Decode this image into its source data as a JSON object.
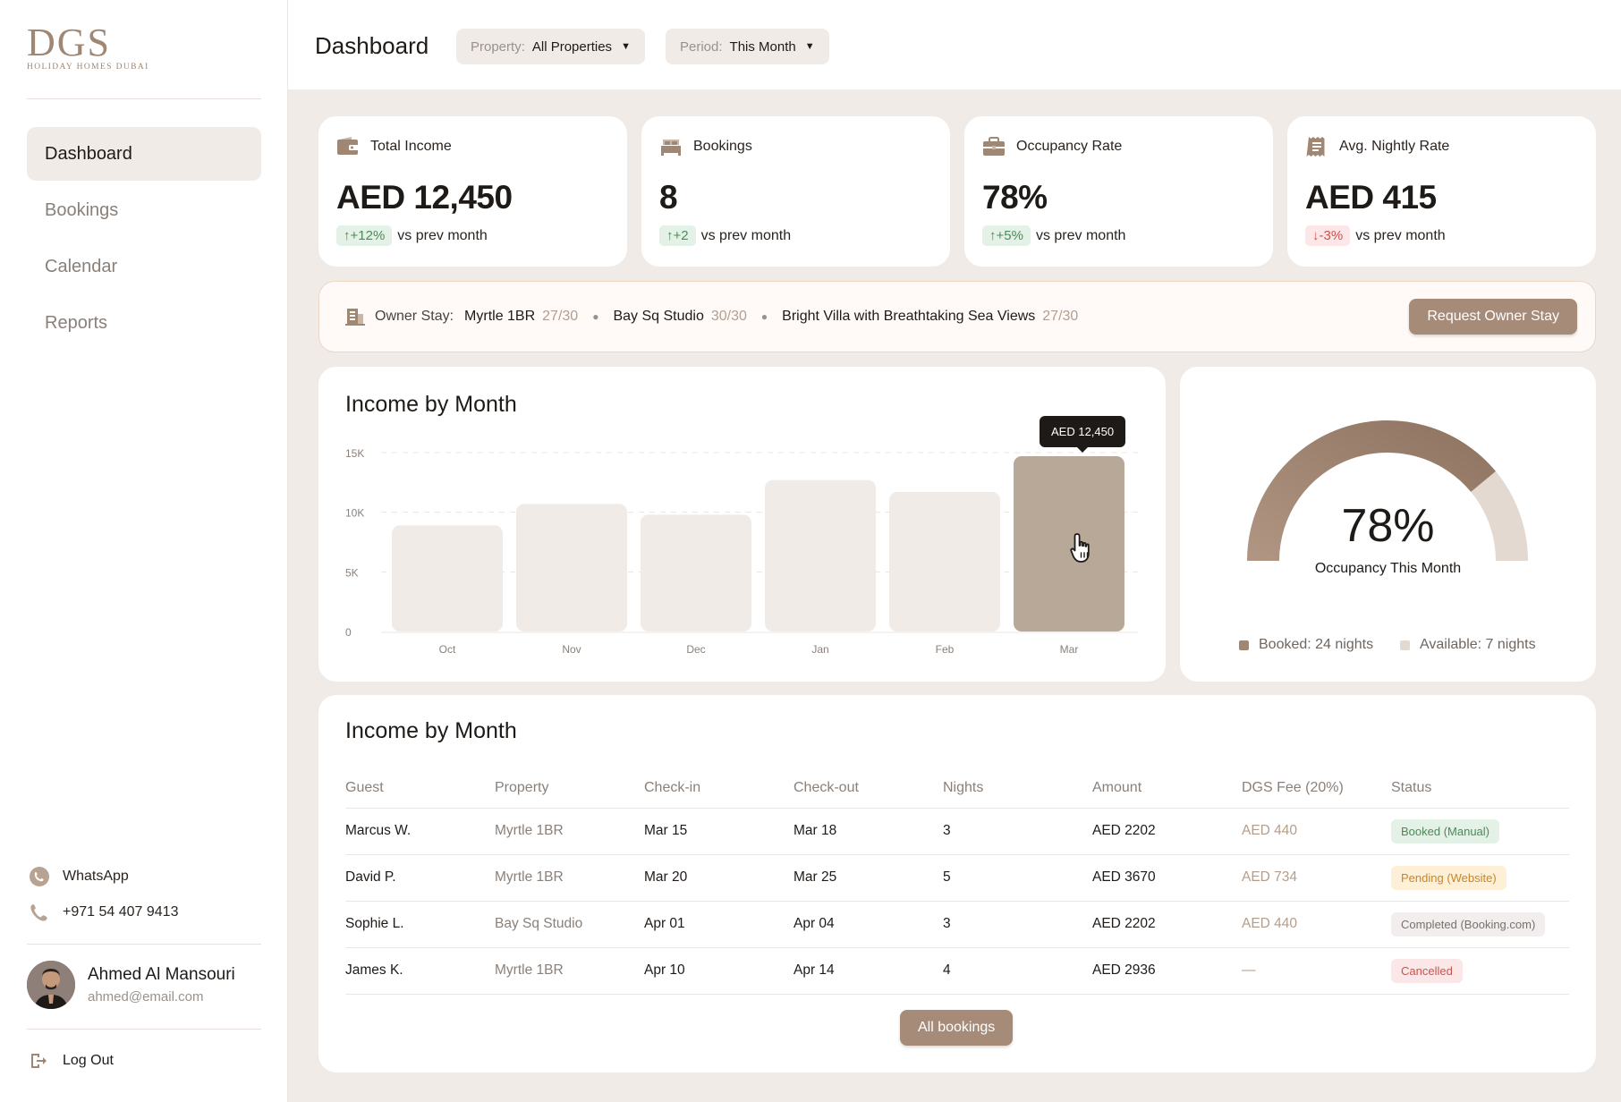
{
  "brand": {
    "logo_text": "DGS",
    "logo_subtitle": "HOLIDAY HOMES DUBAI"
  },
  "sidebar": {
    "items": [
      {
        "label": "Dashboard",
        "active": true
      },
      {
        "label": "Bookings",
        "active": false
      },
      {
        "label": "Calendar",
        "active": false
      },
      {
        "label": "Reports",
        "active": false
      }
    ],
    "whatsapp_label": "WhatsApp",
    "phone": "+971 54 407 9413",
    "user": {
      "name": "Ahmed Al Mansouri",
      "email": "ahmed@email.com"
    },
    "logout_label": "Log Out"
  },
  "header": {
    "title": "Dashboard",
    "property_filter": {
      "label": "Property:",
      "value": "All Properties"
    },
    "period_filter": {
      "label": "Period:",
      "value": "This Month"
    }
  },
  "stats": [
    {
      "label": "Total Income",
      "icon": "wallet-icon",
      "value": "AED 12,450",
      "delta": "↑+12%",
      "trend": "up",
      "compare": "vs prev month"
    },
    {
      "label": "Bookings",
      "icon": "bed-icon",
      "value": "8",
      "delta": "↑+2",
      "trend": "up",
      "compare": "vs prev month"
    },
    {
      "label": "Occupancy Rate",
      "icon": "briefcase-icon",
      "value": "78%",
      "delta": "↑+5%",
      "trend": "up",
      "compare": "vs prev month"
    },
    {
      "label": "Avg. Nightly Rate",
      "icon": "receipt-icon",
      "value": "AED 415",
      "delta": "↓-3%",
      "trend": "down",
      "compare": "vs prev month"
    }
  ],
  "owner_stay": {
    "label": "Owner Stay:",
    "properties": [
      {
        "name": "Myrtle 1BR",
        "count": "27/30"
      },
      {
        "name": "Bay Sq Studio",
        "count": "30/30"
      },
      {
        "name": "Bright Villa with Breathtaking Sea Views",
        "count": "27/30"
      }
    ],
    "button_label": "Request Owner Stay"
  },
  "income_chart": {
    "title": "Income by Month",
    "tooltip": "AED 12,450",
    "highlight_index": 5
  },
  "chart_data": {
    "type": "bar",
    "categories": [
      "Oct",
      "Nov",
      "Dec",
      "Jan",
      "Feb",
      "Mar"
    ],
    "values": [
      8900,
      10700,
      9800,
      12700,
      11700,
      14700
    ],
    "ylim": [
      0,
      15000
    ],
    "yticks": [
      0,
      5000,
      10000,
      15000
    ],
    "ytick_labels": [
      "0",
      "5K",
      "10K",
      "15K"
    ],
    "grid": true,
    "colors": {
      "bar": "#f1ebe8",
      "highlight": "#b8a898"
    }
  },
  "occupancy": {
    "value": "78%",
    "fraction": 0.78,
    "label": "Occupancy This Month",
    "booked_legend": "Booked: 24 nights",
    "available_legend": "Available: 7 nights",
    "colors": {
      "booked": "#a08773",
      "available": "#e3d9d1"
    }
  },
  "bookings_table": {
    "title": "Income by Month",
    "columns": [
      "Guest",
      "Property",
      "Check-in",
      "Check-out",
      "Nights",
      "Amount",
      "DGS Fee (20%)",
      "Status"
    ],
    "rows": [
      {
        "guest": "Marcus W.",
        "property": "Myrtle 1BR",
        "checkin": "Mar 15",
        "checkout": "Mar 18",
        "nights": "3",
        "amount": "AED 2202",
        "fee": "AED 440",
        "status": "Booked (Manual)",
        "status_tone": "green"
      },
      {
        "guest": "David P.",
        "property": "Myrtle 1BR",
        "checkin": "Mar 20",
        "checkout": "Mar 25",
        "nights": "5",
        "amount": "AED 3670",
        "fee": "AED 734",
        "status": "Pending (Website)",
        "status_tone": "yellow"
      },
      {
        "guest": "Sophie L.",
        "property": "Bay Sq Studio",
        "checkin": "Apr 01",
        "checkout": "Apr 04",
        "nights": "3",
        "amount": "AED 2202",
        "fee": "AED 440",
        "status": "Completed (Booking.com)",
        "status_tone": "grey"
      },
      {
        "guest": "James K.",
        "property": "Myrtle 1BR",
        "checkin": "Apr 10",
        "checkout": "Apr 14",
        "nights": "4",
        "amount": "AED 2936",
        "fee": "—",
        "status": "Cancelled",
        "status_tone": "red"
      }
    ],
    "all_button_label": "All bookings"
  }
}
